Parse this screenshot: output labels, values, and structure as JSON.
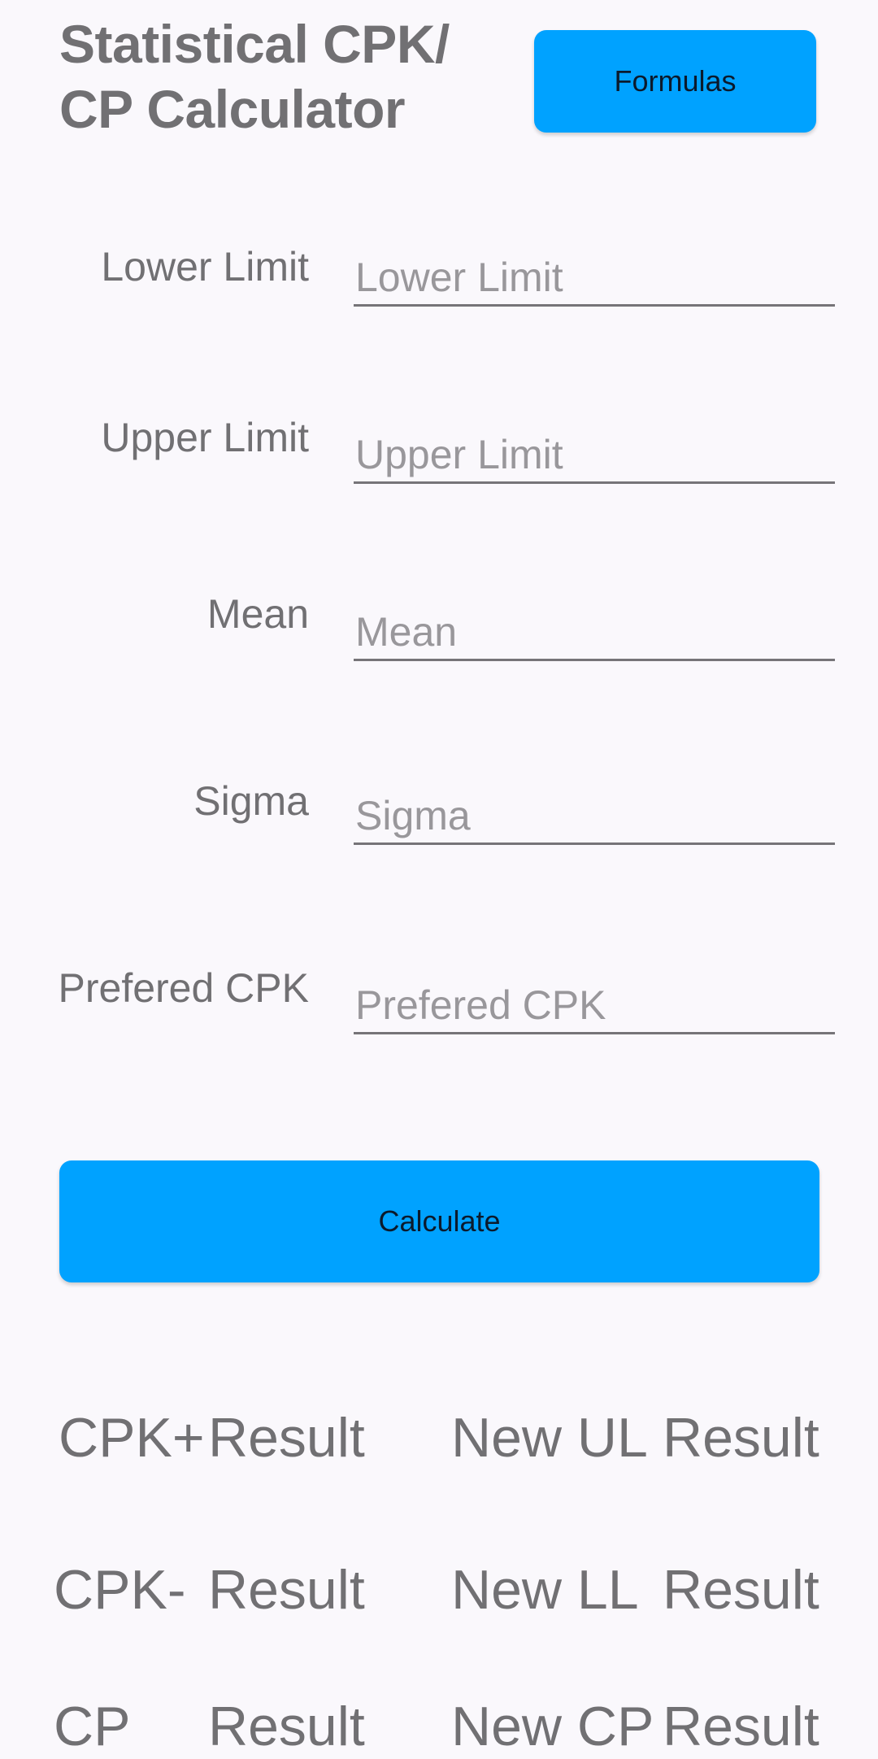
{
  "header": {
    "title_line1": "Statistical CPK/",
    "title_line2": "CP Calculator",
    "formulas_label": "Formulas"
  },
  "colors": {
    "accent": "#00A2FF",
    "background": "#FAF8FC",
    "text": "#717073",
    "placeholder": "#99979B"
  },
  "fields": [
    {
      "label": "Lower Limit",
      "placeholder": "Lower Limit",
      "value": ""
    },
    {
      "label": "Upper Limit",
      "placeholder": "Upper Limit",
      "value": ""
    },
    {
      "label": "Mean",
      "placeholder": "Mean",
      "value": ""
    },
    {
      "label": "Sigma",
      "placeholder": "Sigma",
      "value": ""
    },
    {
      "label": "Prefered CPK",
      "placeholder": "Prefered CPK",
      "value": ""
    }
  ],
  "calculate_label": "Calculate",
  "results": [
    {
      "label": "CPK+",
      "value": "Result",
      "new_label": "New UL",
      "new_value": "Result"
    },
    {
      "label": "CPK-",
      "value": "Result",
      "new_label": "New LL",
      "new_value": "Result"
    },
    {
      "label": "CP",
      "value": "Result",
      "new_label": "New CP",
      "new_value": "Result"
    }
  ]
}
